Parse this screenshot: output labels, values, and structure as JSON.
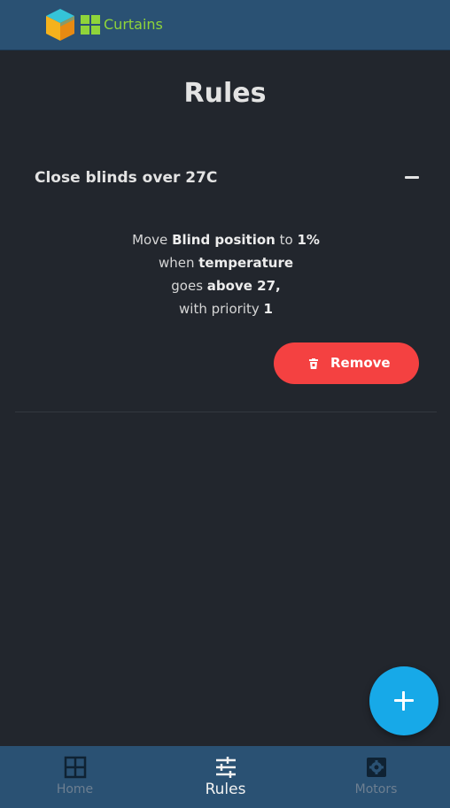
{
  "header": {
    "brand": "Curtains",
    "colors": {
      "bar": "#2a5173",
      "brand_text": "#8fd43a"
    }
  },
  "page": {
    "title": "Rules"
  },
  "rule": {
    "title": "Close blinds over 27C",
    "collapse_icon": "minus-icon",
    "desc": {
      "w_move": "Move",
      "target": "Blind position",
      "w_to": "to",
      "value": "1%",
      "w_when": "when",
      "sensor": "temperature",
      "w_goes": "goes",
      "condition": "above 27,",
      "w_priority": "with priority",
      "priority": "1"
    },
    "remove_label": "Remove",
    "remove_icon": "trash-icon",
    "remove_color": "#f44141"
  },
  "fab": {
    "icon": "plus-icon",
    "color": "#17a9e8"
  },
  "nav": {
    "items": [
      {
        "label": "Home",
        "icon": "grid-icon",
        "active": false
      },
      {
        "label": "Rules",
        "icon": "sliders-icon",
        "active": true
      },
      {
        "label": "Motors",
        "icon": "gear-icon",
        "active": false
      }
    ]
  }
}
